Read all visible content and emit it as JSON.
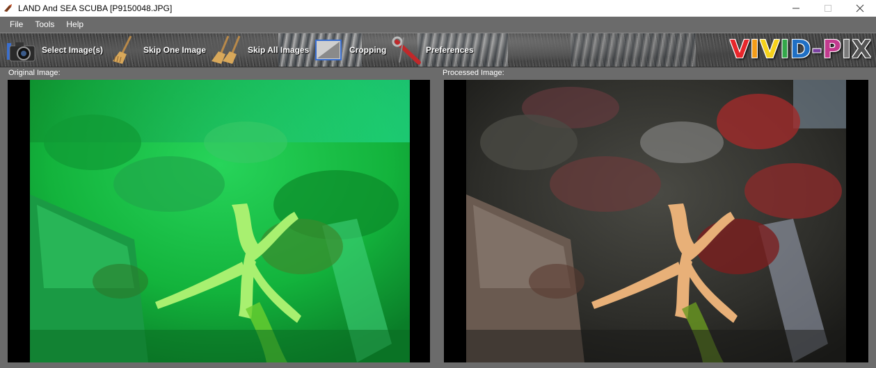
{
  "window": {
    "title": "LAND And SEA SCUBA  [P9150048.JPG]",
    "app_icon": "fish-icon",
    "controls": [
      "minimize-icon",
      "maximize-icon",
      "close-icon"
    ]
  },
  "menu": {
    "items": [
      {
        "label": "File"
      },
      {
        "label": "Tools"
      },
      {
        "label": "Help"
      }
    ]
  },
  "toolbar": {
    "buttons": [
      {
        "label": "Select Image(s)",
        "icon": "camera-icon"
      },
      {
        "label": "Skip One Image",
        "icon": "broom-icon"
      },
      {
        "label": "Skip All Images",
        "icon": "brooms-icon"
      },
      {
        "label": "Cropping",
        "icon": "crop-icon"
      },
      {
        "label": "Preferences",
        "icon": "wrench-icon"
      }
    ],
    "logo_letters": [
      {
        "ch": "V",
        "color": "#e8262b"
      },
      {
        "ch": "I",
        "color": "#f39c1a"
      },
      {
        "ch": "V",
        "color": "#f6d21b"
      },
      {
        "ch": "I",
        "color": "#34a84a"
      },
      {
        "ch": "D",
        "color": "#1f6fc4"
      },
      {
        "ch": "-",
        "color": "#7a3fa0"
      },
      {
        "ch": "P",
        "color": "#c23a8e"
      },
      {
        "ch": "I",
        "color": "#7a7a7a"
      },
      {
        "ch": "X",
        "color": "#555555"
      }
    ]
  },
  "panels": {
    "original_label": "Original Image:",
    "processed_label": "Processed Image:"
  },
  "colors": {
    "chrome_gray": "#6b6b6b",
    "original_tint": "#1fc24a",
    "processed_tint": "#3a3a36"
  }
}
